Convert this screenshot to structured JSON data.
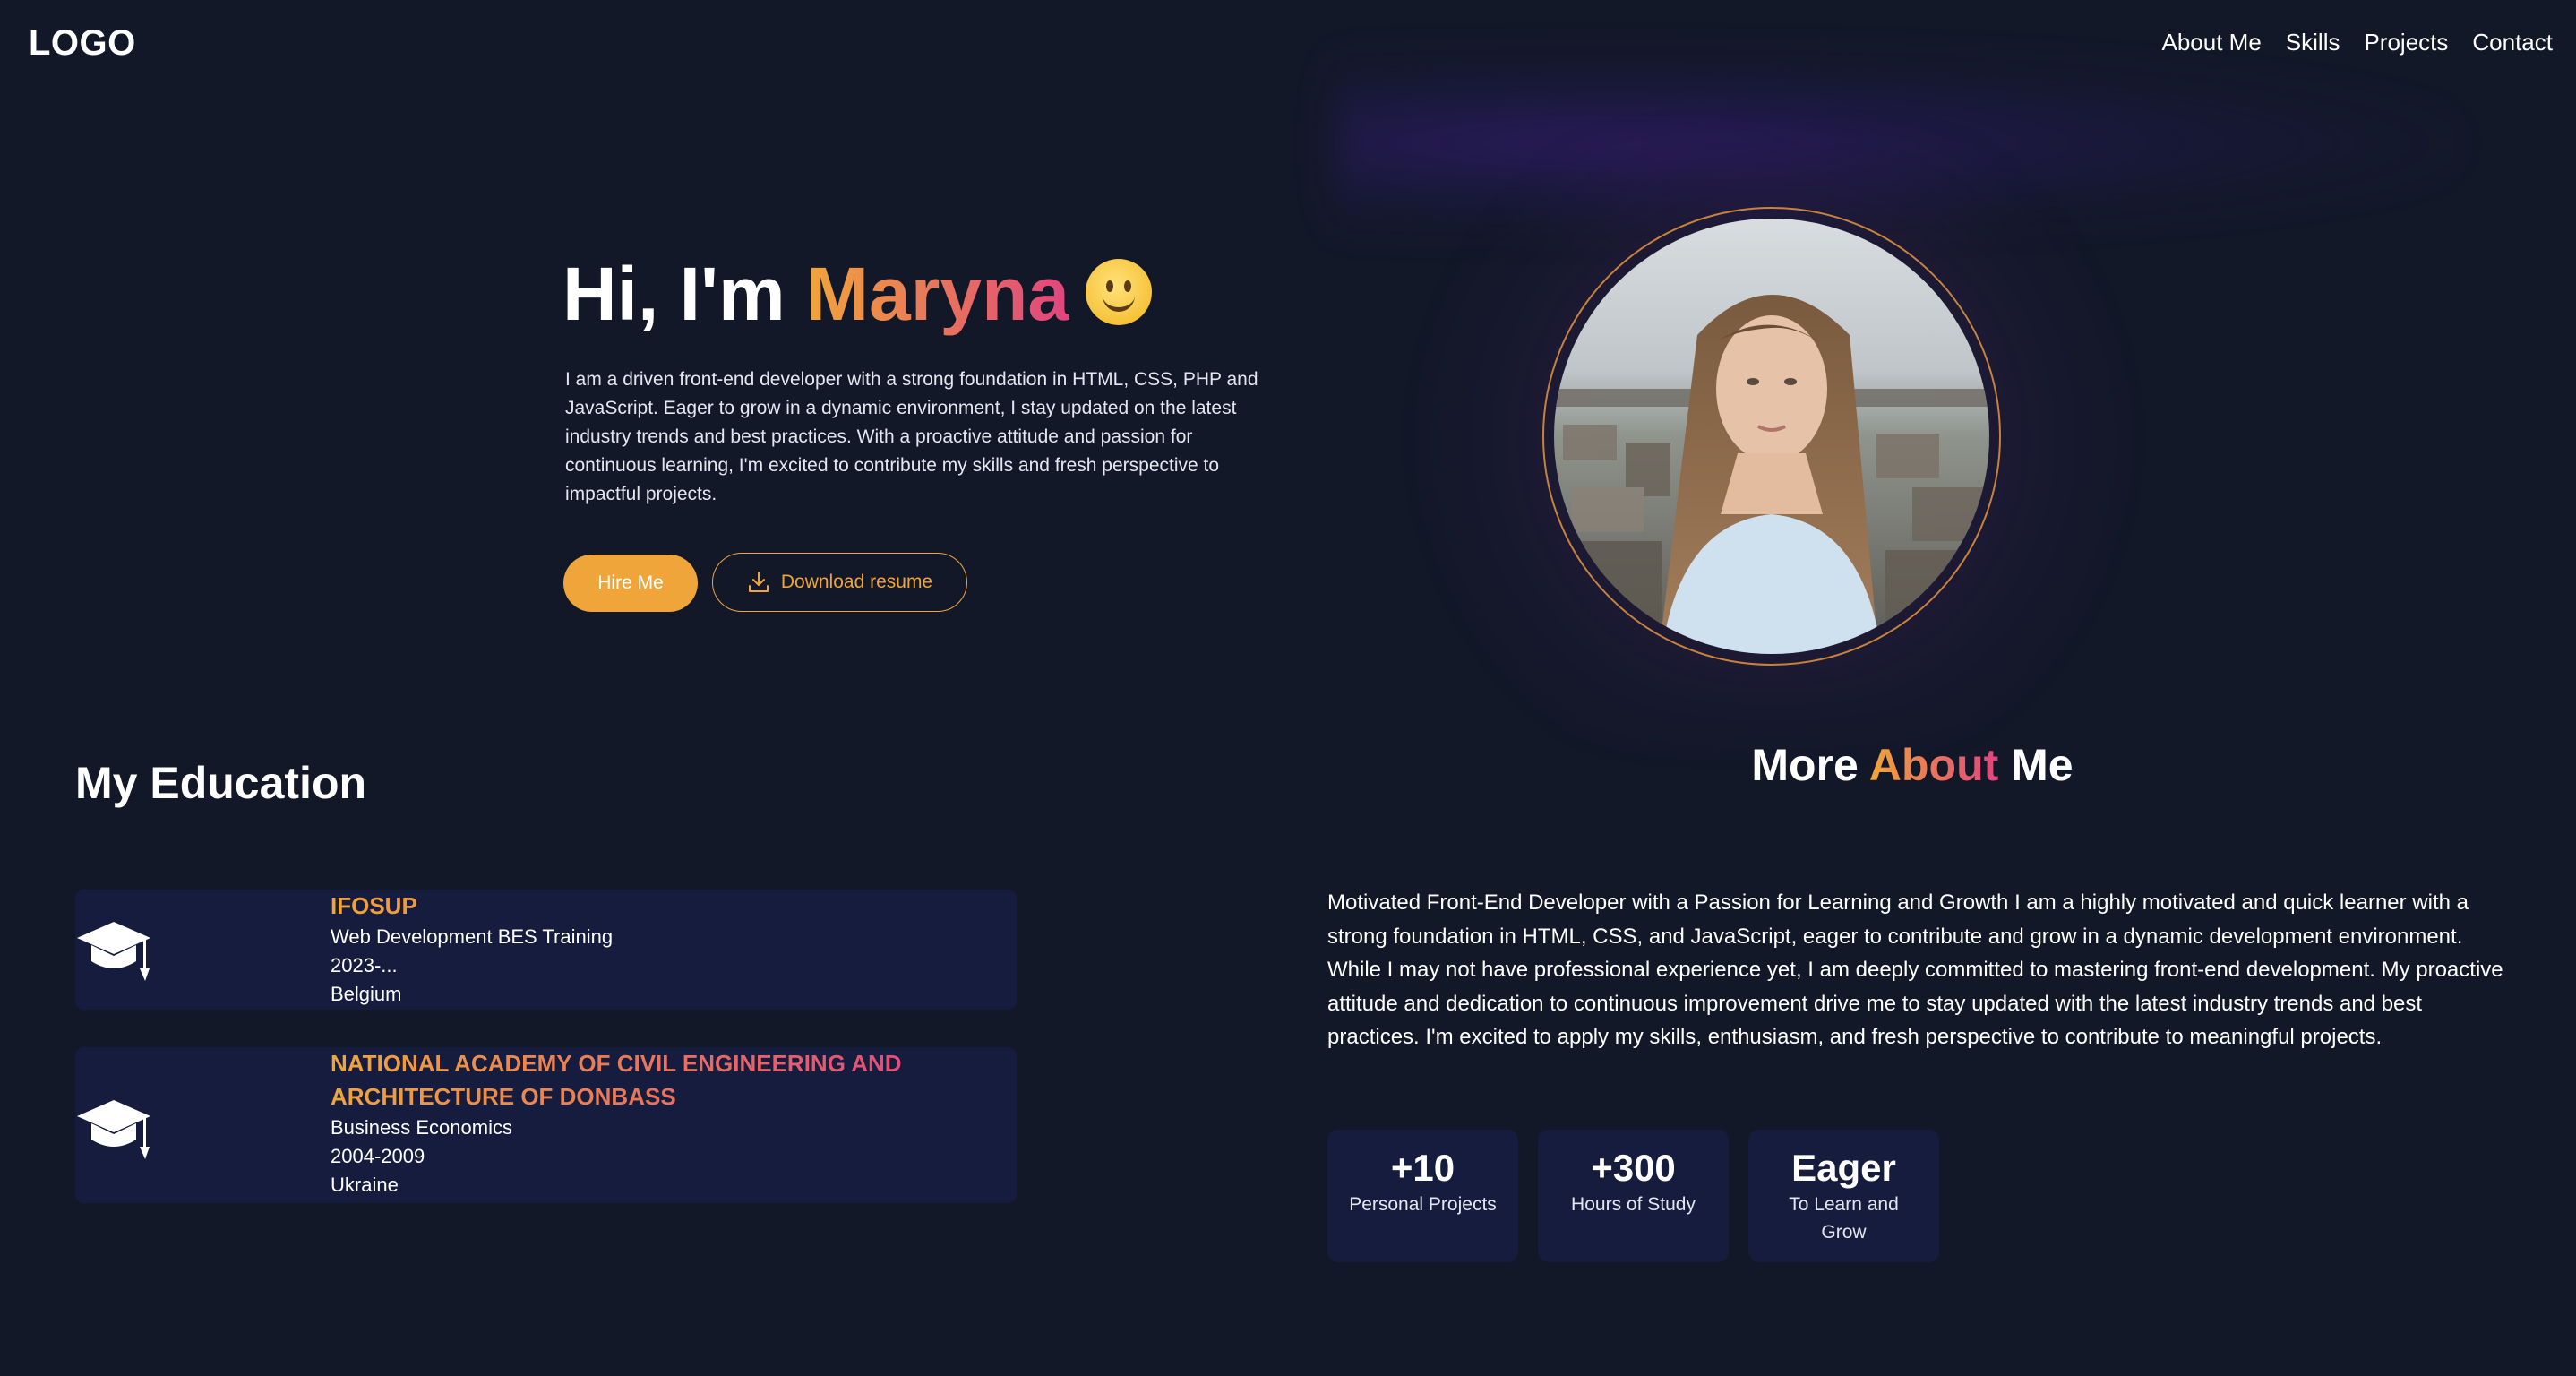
{
  "header": {
    "logo": "LOGO",
    "nav": [
      "About Me",
      "Skills",
      "Projects",
      "Contact"
    ]
  },
  "hero": {
    "greeting": "Hi, I'm ",
    "name": "Maryna",
    "emoji": "slightly-smiling-face-emoji",
    "description": "I am a driven front-end developer with a strong foundation in HTML, CSS, PHP and JavaScript. Eager to grow in a dynamic environment, I stay updated on the latest industry trends and best practices. With a proactive attitude and passion for continuous learning, I'm excited to contribute my skills and fresh perspective to impactful projects.",
    "hire_label": "Hire Me",
    "resume_label": "Download resume"
  },
  "education": {
    "title": "My Education",
    "items": [
      {
        "school": "IFOSUP",
        "program": "Web Development BES Training",
        "years": "2023-...",
        "country": "Belgium"
      },
      {
        "school": "NATIONAL ACADEMY OF CIVIL ENGINEERING AND ARCHITECTURE OF DONBASS",
        "program": "Business Economics",
        "years": "2004-2009",
        "country": "Ukraine"
      }
    ]
  },
  "about": {
    "title_pre": "More ",
    "title_accent": "About",
    "title_post": " Me",
    "text": "Motivated Front-End Developer with a Passion for Learning and Growth I am a highly motivated and quick learner with a strong foundation in HTML, CSS, and JavaScript, eager to contribute and grow in a dynamic development environment. While I may not have professional experience yet, I am deeply committed to mastering front-end development. My proactive attitude and dedication to continuous improvement drive me to stay updated with the latest industry trends and best practices. I'm excited to apply my skills, enthusiasm, and fresh perspective to contribute to meaningful projects.",
    "stats": [
      {
        "value": "+10",
        "label": "Personal Projects"
      },
      {
        "value": "+300",
        "label": "Hours of Study"
      },
      {
        "value": "Eager",
        "label": "To Learn and Grow"
      }
    ]
  },
  "colors": {
    "background": "#131829",
    "card": "#151c3d",
    "accent_orange": "#f0a53a",
    "accent_pink": "#e0457e"
  },
  "icons": [
    "download-icon",
    "graduation-cap-icon"
  ]
}
